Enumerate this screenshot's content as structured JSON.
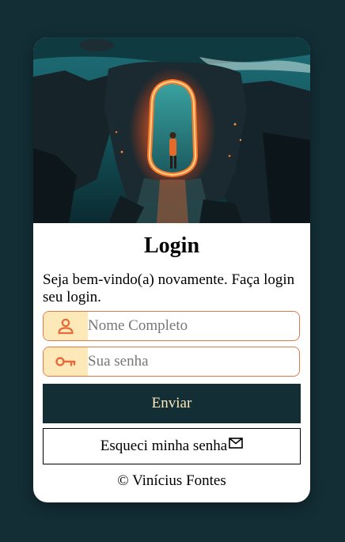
{
  "login": {
    "title": "Login",
    "subtitle": "Seja bem-vindo(a) novamente. Faça login seu login.",
    "name_placeholder": "Nome Completo",
    "password_placeholder": "Sua senha",
    "submit_label": "Enviar",
    "forgot_label": "Esqueci minha senha",
    "footer": "© Vinícius Fontes"
  },
  "icons": {
    "name_field": "user-icon",
    "password_field": "key-icon",
    "forgot_button": "mail-icon"
  },
  "colors": {
    "page_background": "#132e35",
    "card_background": "#ffffff",
    "field_border": "#e07a4c",
    "icon_box": "#fde8b8",
    "icon": "#e8693a",
    "button_background": "#132e35",
    "button_text": "#fde8b8"
  }
}
